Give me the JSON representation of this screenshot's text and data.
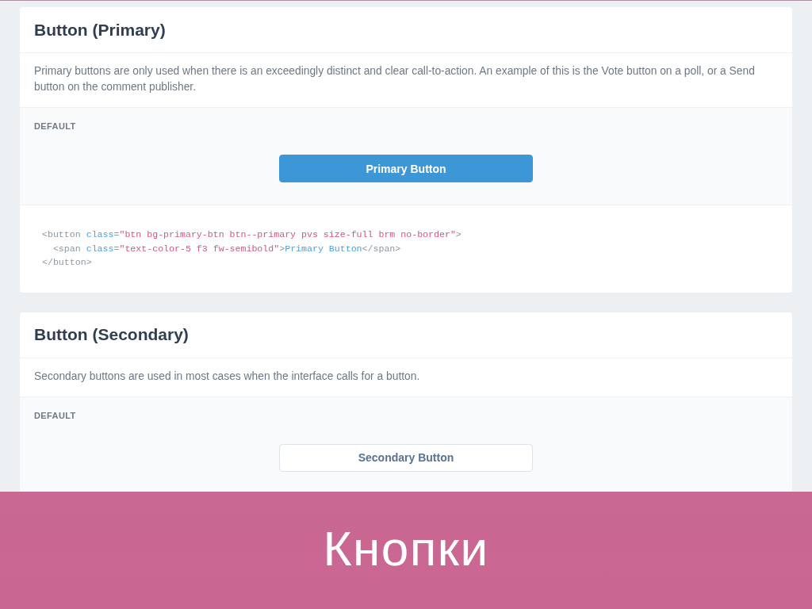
{
  "sections": [
    {
      "title": "Button (Primary)",
      "description": "Primary buttons are only used when there is an exceedingly distinct and clear call-to-action. An example of this is the Vote button on a poll, or a Send button on the comment publisher.",
      "demo": {
        "label": "DEFAULT",
        "button": {
          "kind": "primary",
          "label": "Primary Button"
        }
      },
      "code": [
        {
          "tokens": [
            {
              "kind": "tag",
              "text": "<button"
            },
            {
              "kind": "attr",
              "text": "class"
            },
            {
              "kind": "tag",
              "text": "="
            },
            {
              "kind": "string",
              "text": "\"btn bg-primary-btn btn--primary pvs size-full brm no-border\""
            },
            {
              "kind": "tag",
              "text": ">"
            }
          ],
          "children": [
            {
              "tokens": [
                {
                  "kind": "tag",
                  "text": "<span"
                },
                {
                  "kind": "attr",
                  "text": "class"
                },
                {
                  "kind": "tag",
                  "text": "="
                },
                {
                  "kind": "string",
                  "text": "\"text-color-5 f3 fw-semibold\""
                },
                {
                  "kind": "tag",
                  "text": ">"
                },
                {
                  "kind": "text",
                  "text": "Primary Button"
                },
                {
                  "kind": "tag",
                  "text": "</span>"
                }
              ]
            }
          ]
        },
        {
          "tokens": [
            {
              "kind": "tag",
              "text": "</button>"
            }
          ]
        }
      ]
    },
    {
      "title": "Button (Secondary)",
      "description": "Secondary buttons are used in most cases when the interface calls for a button.",
      "demo": {
        "label": "DEFAULT",
        "button": {
          "kind": "secondary",
          "label": "Secondary Button"
        }
      }
    }
  ],
  "banner": {
    "title": "Кнопки"
  }
}
